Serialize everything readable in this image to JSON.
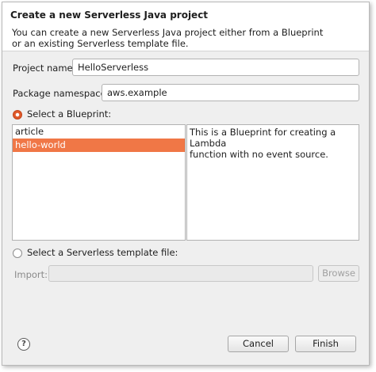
{
  "header": {
    "title": "Create a new Serverless Java project",
    "description_line1": "You can create a new Serverless Java project either from a Blueprint",
    "description_line2": "or an existing Serverless template file."
  },
  "form": {
    "project_name_label": "Project name:",
    "project_name_value": "HelloServerless",
    "package_namespace_label": "Package namespace:",
    "package_namespace_value": "aws.example"
  },
  "blueprint": {
    "radio_label": "Select a Blueprint:",
    "selected": true,
    "items": [
      {
        "label": "article",
        "selected": false
      },
      {
        "label": "hello-world",
        "selected": true
      }
    ],
    "description_line1": "This is a Blueprint for creating a Lambda",
    "description_line2": "function with no event source."
  },
  "template": {
    "radio_label": "Select a Serverless template file:",
    "selected": false,
    "import_label": "Import:",
    "import_value": "",
    "browse_label": "Browse"
  },
  "footer": {
    "help_icon": "help-question-icon",
    "help_glyph": "?",
    "cancel_label": "Cancel",
    "finish_label": "Finish"
  },
  "colors": {
    "accent": "#f07746",
    "radio_checked": "#e0592a"
  }
}
